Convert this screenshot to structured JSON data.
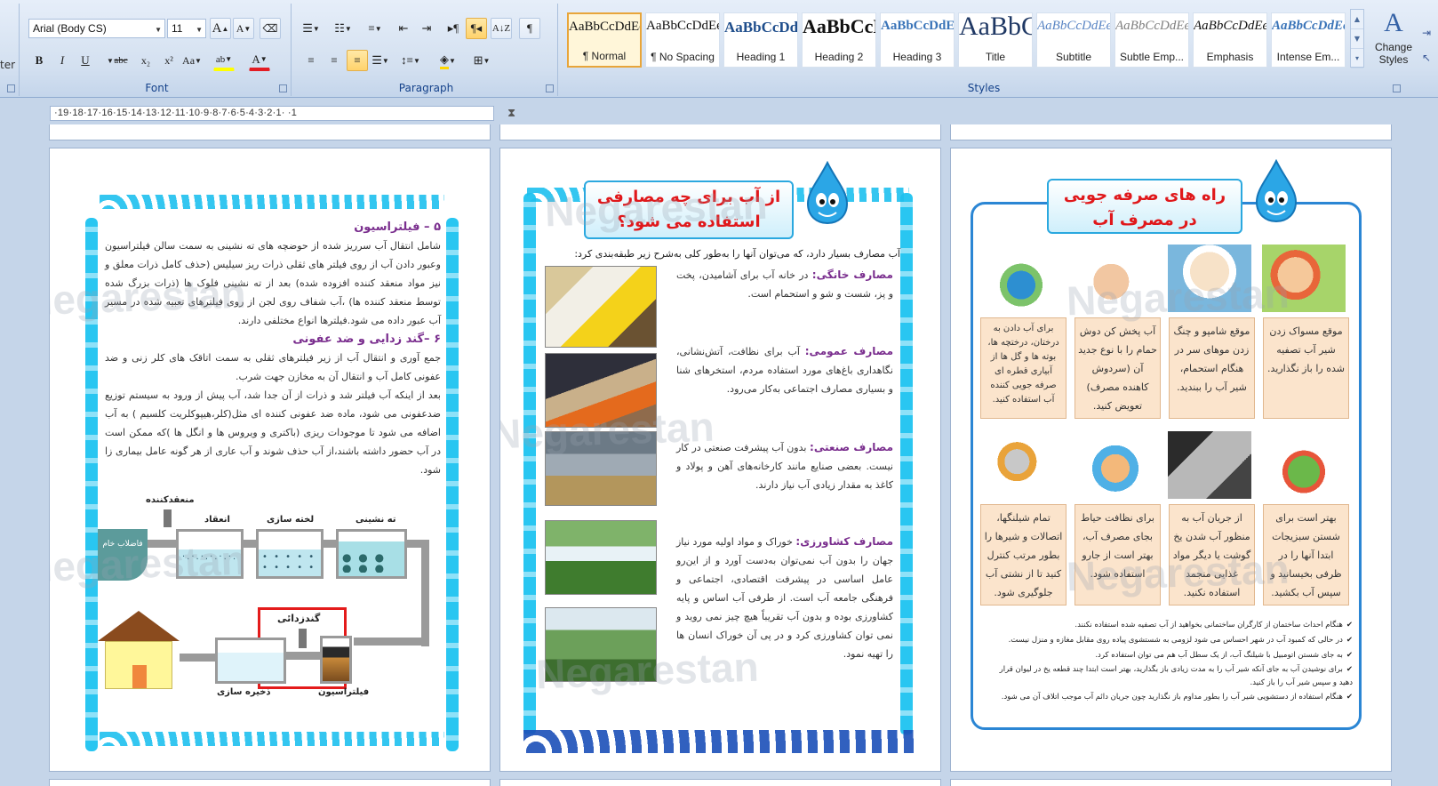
{
  "ribbon": {
    "clipboard_stub_label": "ter",
    "font": {
      "label": "Font",
      "name": "Arial (Body CS)",
      "size": "11",
      "grow_glyph": "A",
      "shrink_glyph": "A",
      "bold": "B",
      "italic": "I",
      "underline": "U",
      "strike": "abc",
      "subscript": "x₂",
      "superscript": "x²",
      "change_case": "Aa",
      "highlight": "ab",
      "font_color": "A"
    },
    "paragraph": {
      "label": "Paragraph",
      "pilcrow": "¶"
    },
    "styles": {
      "label": "Styles",
      "tiles": [
        {
          "sample": "AaBbCcDdEe",
          "name": "¶ Normal"
        },
        {
          "sample": "AaBbCcDdEe",
          "name": "¶ No Spacing"
        },
        {
          "sample": "AaBbCcDdEe",
          "name": "Heading 1"
        },
        {
          "sample": "AaBbCcDdEe",
          "name": "Heading 2"
        },
        {
          "sample": "AaBbCcDdEe",
          "name": "Heading 3"
        },
        {
          "sample": "AaBbCcDdEe",
          "name": "Title"
        },
        {
          "sample": "AaBbCcDdEe",
          "name": "Subtitle"
        },
        {
          "sample": "AaBbCcDdEe",
          "name": "Subtle Emp..."
        },
        {
          "sample": "AaBbCcDdEe",
          "name": "Emphasis"
        },
        {
          "sample": "AaBbCcDdEe",
          "name": "Intense Em..."
        }
      ],
      "change_styles_line1": "Change",
      "change_styles_line2": "Styles"
    }
  },
  "ruler": {
    "marks": "·19·18·17·16·15·14·13·12·11·10·9·8·7·6·5·4·3·2·1· ·1"
  },
  "watermark": "Negarestan",
  "page_left": {
    "heading_filtration": "۵ – فیلتراسیون",
    "text_filtration": "شامل انتقال آب سرریز شده از حوضچه های ته نشینی به سمت سالن فیلتراسیون وعبور دادن آب از روی فیلتر های ثقلی ذرات ریز سیلیس (حذف کامل ذرات معلق و نیز مواد منعقد کننده افزوده شده) بعد از ته نشینی فلوک ها (ذرات بزرگ شده توسط منعقد کننده ها) ،آب شفاف روی لجن از روی فیلترهای تعبیه شده در مسیر آب عبور داده می شود.فیلترها انواع مختلفی دارند.",
    "heading_disinfection": "۶ –گند زدایی و ضد عفونی",
    "text_disinfection_1": "جمع آوری و انتقال آب از زیر فیلترهای ثقلی به سمت اتاقک های کلر زنی و ضد عفونی کامل آب و انتقال آن به مخازن جهت شرب.",
    "text_disinfection_2": "بعد از اینکه آب فیلتر شد و ذرات از آن جدا شد، آب پیش از ورود به سیستم توزیع ضدعفونی می شود، ماده ضد عفونی کننده ای مثل(کلر،هیپوکلریت کلسیم ) به آب اضافه می شود تا موجودات ریزی (باکتری و ویروس ها و انگل ها )که ممکن است در آب حضور داشته باشند،از آب حذف شوند و آب عاری از هر گونه عامل بیماری زا شود.",
    "diagram": {
      "coagulant": "منعقدکننده",
      "raw_water": "فاضلاب خام",
      "coagulation": "انعقاد",
      "flocculation": "لخته سازی",
      "sedimentation": "ته نشینی",
      "disinfection": "گندزدائی",
      "storage": "ذخیره سازی",
      "filtration": "فیلتراسیون"
    }
  },
  "page_middle": {
    "title_line1": "از آب برای چه مصارفی",
    "title_line2": "استفاده می شود؟",
    "intro": "آب مصارف بسیار دارد، که می‌توان آنها را به‌طور کلی به‌شرح زیر طبقه‌بندی کرد:",
    "uses": [
      {
        "head": "مصارف خانگی:",
        "text": "در خانه آب برای آشامیدن، پخت و پز، شست و شو و استحمام است."
      },
      {
        "head": "مصارف عمومی:",
        "text": "آب برای نظافت، آتش‌نشانی، نگاهداری باغ‌های مورد استفاده مردم، استخرهای شنا و بسیاری مصارف اجتماعی به‌کار می‌رود."
      },
      {
        "head": "مصارف صنعتی:",
        "text": "بدون آب پیشرفت صنعتی در کار نیست. بعضی صنایع مانند کارخانه‌های آهن و پولاد و کاغذ به مقدار زیادی آب نیاز دارند."
      },
      {
        "head": "مصارف کشاورزی:",
        "text": "خوراک و مواد اولیه مورد نیاز جهان را بدون آب نمی‌توان به‌دست آورد و از این‌رو عامل اساسی در پیشرفت اقتصادی، اجتماعی و فرهنگی جامعه آب است. از طرفی آب اساس و پایه کشاورزی بوده و بدون آب تقریباً هیچ چیز نمی روید و نمی توان کشاورزی کرد و در پی آن خوراک انسان ها را تهیه نمود."
      }
    ]
  },
  "page_right": {
    "title_line1": "راه های صرفه جویی",
    "title_line2": "در مصرف آب",
    "tips_row1": [
      "موقع مسواک زدن شیر آب تصفیه شده را باز نگذارید.",
      "موقع شامپو و چنگ زدن موهای سر در هنگام استحمام، شیر آب را ببندید.",
      "آب پخش کن دوش حمام را با نوع جدید آن (سردوش کاهنده مصرف) تعویض کنید.",
      "برای آب دادن به درختان، درختچه ها، بوته ها و گل ها از آبیاری قطره ای صرفه جویی کننده آب استفاده کنید."
    ],
    "tips_row2": [
      "بهتر است برای شستن سبزیجات ابتدا آنها را در ظرفی بخیسانید و سپس آب بکشید.",
      "از جریان آب به منظور آب شدن یخ گوشت یا دیگر مواد غذایی منجمد استفاده نکنید.",
      "برای نظافت حیاط بجای مصرف آب، بهتر است از جارو استفاده شود.",
      "تمام شیلنگها، اتصالات و شیرها را بطور مرتب کنترل کنید تا از نشتی آب جلوگیری شود."
    ],
    "checks": [
      "هنگام احداث ساختمان از کارگران ساختمانی بخواهید از آب تصفیه شده استفاده نکنند.",
      "در حالی که کمبود آب در شهر احساس می شود لزومی به شستشوی پیاده روی مقابل مغازه و منزل نیست.",
      "به جای شستن اتومبیل با شیلنگ آب، از یک سطل آب هم می توان استفاده کرد.",
      "برای نوشیدن آب به جای آنکه شیر آب را به مدت زیادی باز بگذارید، بهتر است ابتدا چند قطعه یخ در لیوان قرار دهید و سپس شیر آب را باز کنید.",
      "هنگام استفاده از دستشویی شیر آب را بطور مداوم باز نگذارید چون جریان دائم آب موجب اتلاف آن می شود."
    ],
    "check_mark": "✔"
  },
  "colors": {
    "accent_purple": "#7a2e8e",
    "title_red": "#e0181b",
    "water_blue": "#1ec0ee",
    "tip_card": "#fbe4cc"
  }
}
